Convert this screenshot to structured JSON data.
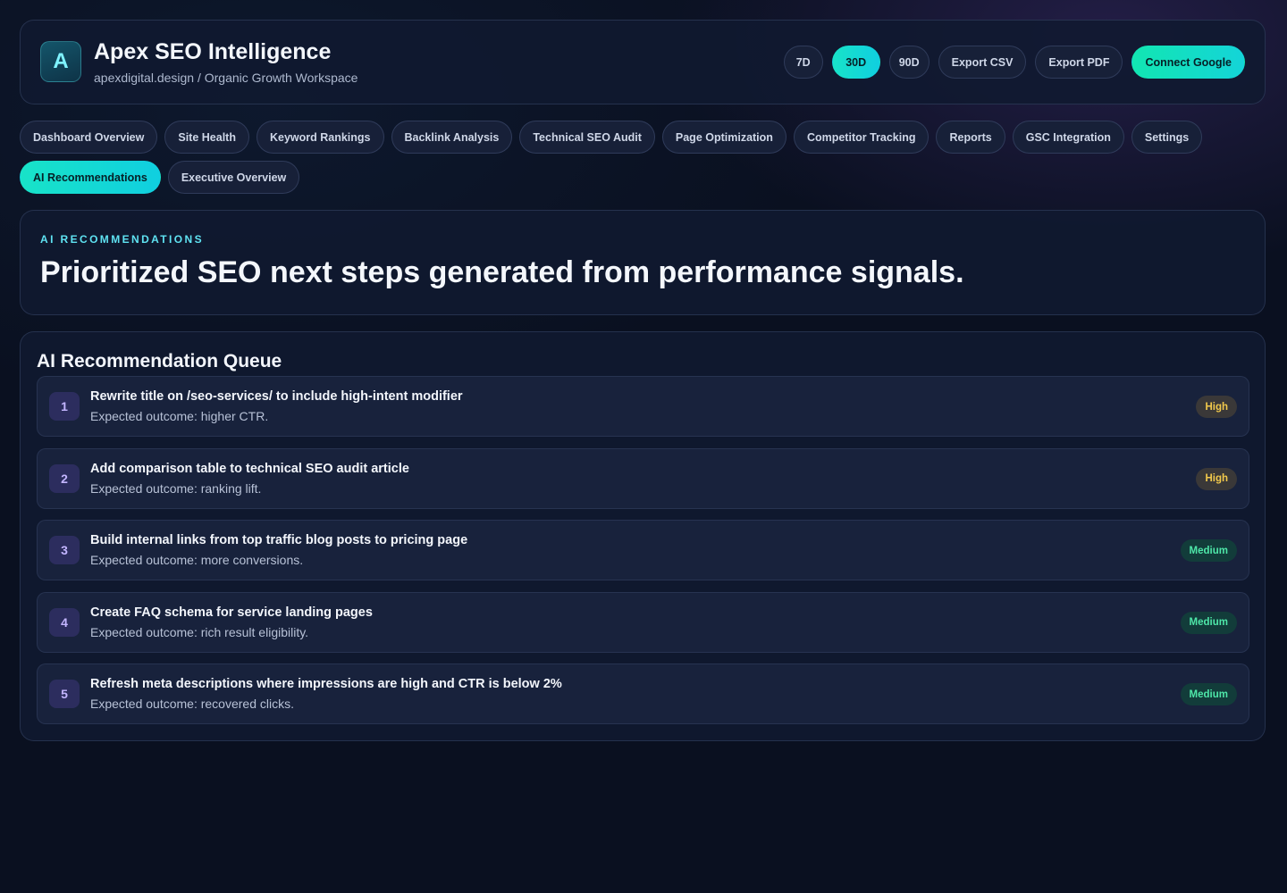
{
  "header": {
    "logo_letter": "A",
    "title": "Apex SEO Intelligence",
    "subtitle": "apexdigital.design / Organic Growth Workspace",
    "ranges": [
      "7D",
      "30D",
      "90D"
    ],
    "active_range": "30D",
    "export_csv": "Export CSV",
    "export_pdf": "Export PDF",
    "connect_google": "Connect Google"
  },
  "nav": {
    "tabs": [
      "Dashboard Overview",
      "Site Health",
      "Keyword Rankings",
      "Backlink Analysis",
      "Technical SEO Audit",
      "Page Optimization",
      "Competitor Tracking",
      "Reports",
      "GSC Integration",
      "Settings",
      "AI Recommendations",
      "Executive Overview"
    ],
    "active_tab": "AI Recommendations"
  },
  "hero": {
    "eyebrow": "AI RECOMMENDATIONS",
    "title": "Prioritized SEO next steps generated from performance signals."
  },
  "queue": {
    "title": "AI Recommendation Queue",
    "items": [
      {
        "num": "1",
        "title": "Rewrite title on /seo-services/ to include high-intent modifier",
        "outcome": "Expected outcome: higher CTR.",
        "priority": "High"
      },
      {
        "num": "2",
        "title": "Add comparison table to technical SEO audit article",
        "outcome": "Expected outcome: ranking lift.",
        "priority": "High"
      },
      {
        "num": "3",
        "title": "Build internal links from top traffic blog posts to pricing page",
        "outcome": "Expected outcome: more conversions.",
        "priority": "Medium"
      },
      {
        "num": "4",
        "title": "Create FAQ schema for service landing pages",
        "outcome": "Expected outcome: rich result eligibility.",
        "priority": "Medium"
      },
      {
        "num": "5",
        "title": "Refresh meta descriptions where impressions are high and CTR is below 2%",
        "outcome": "Expected outcome: recovered clicks.",
        "priority": "Medium"
      }
    ]
  },
  "colors": {
    "background": "#0a1020",
    "accent_teal": "#14d4d8",
    "badge_high": "#f2c94c",
    "badge_medium": "#4ee6a8"
  }
}
